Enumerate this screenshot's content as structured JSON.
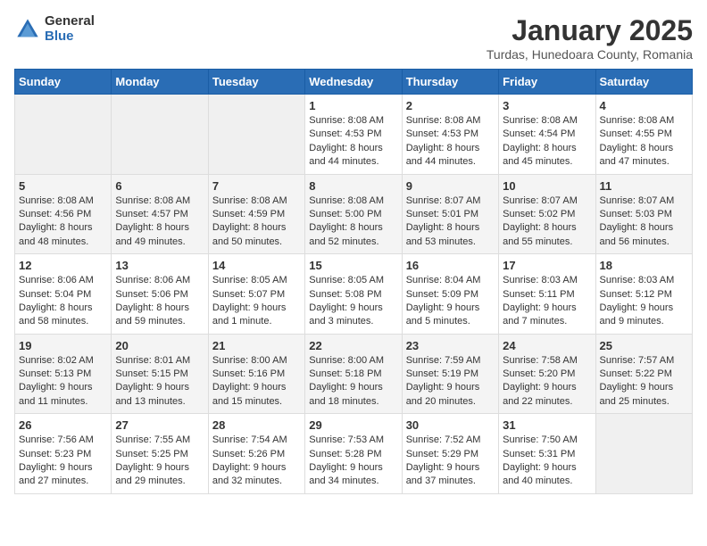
{
  "logo": {
    "general": "General",
    "blue": "Blue"
  },
  "calendar": {
    "title": "January 2025",
    "subtitle": "Turdas, Hunedoara County, Romania"
  },
  "weekdays": [
    "Sunday",
    "Monday",
    "Tuesday",
    "Wednesday",
    "Thursday",
    "Friday",
    "Saturday"
  ],
  "weeks": [
    [
      {
        "day": null
      },
      {
        "day": null
      },
      {
        "day": null
      },
      {
        "day": "1",
        "sunrise": "8:08 AM",
        "sunset": "4:53 PM",
        "daylight": "8 hours and 44 minutes."
      },
      {
        "day": "2",
        "sunrise": "8:08 AM",
        "sunset": "4:53 PM",
        "daylight": "8 hours and 44 minutes."
      },
      {
        "day": "3",
        "sunrise": "8:08 AM",
        "sunset": "4:54 PM",
        "daylight": "8 hours and 45 minutes."
      },
      {
        "day": "4",
        "sunrise": "8:08 AM",
        "sunset": "4:55 PM",
        "daylight": "8 hours and 47 minutes."
      }
    ],
    [
      {
        "day": "5",
        "sunrise": "8:08 AM",
        "sunset": "4:56 PM",
        "daylight": "8 hours and 48 minutes."
      },
      {
        "day": "6",
        "sunrise": "8:08 AM",
        "sunset": "4:57 PM",
        "daylight": "8 hours and 49 minutes."
      },
      {
        "day": "7",
        "sunrise": "8:08 AM",
        "sunset": "4:59 PM",
        "daylight": "8 hours and 50 minutes."
      },
      {
        "day": "8",
        "sunrise": "8:08 AM",
        "sunset": "5:00 PM",
        "daylight": "8 hours and 52 minutes."
      },
      {
        "day": "9",
        "sunrise": "8:07 AM",
        "sunset": "5:01 PM",
        "daylight": "8 hours and 53 minutes."
      },
      {
        "day": "10",
        "sunrise": "8:07 AM",
        "sunset": "5:02 PM",
        "daylight": "8 hours and 55 minutes."
      },
      {
        "day": "11",
        "sunrise": "8:07 AM",
        "sunset": "5:03 PM",
        "daylight": "8 hours and 56 minutes."
      }
    ],
    [
      {
        "day": "12",
        "sunrise": "8:06 AM",
        "sunset": "5:04 PM",
        "daylight": "8 hours and 58 minutes."
      },
      {
        "day": "13",
        "sunrise": "8:06 AM",
        "sunset": "5:06 PM",
        "daylight": "8 hours and 59 minutes."
      },
      {
        "day": "14",
        "sunrise": "8:05 AM",
        "sunset": "5:07 PM",
        "daylight": "9 hours and 1 minute."
      },
      {
        "day": "15",
        "sunrise": "8:05 AM",
        "sunset": "5:08 PM",
        "daylight": "9 hours and 3 minutes."
      },
      {
        "day": "16",
        "sunrise": "8:04 AM",
        "sunset": "5:09 PM",
        "daylight": "9 hours and 5 minutes."
      },
      {
        "day": "17",
        "sunrise": "8:03 AM",
        "sunset": "5:11 PM",
        "daylight": "9 hours and 7 minutes."
      },
      {
        "day": "18",
        "sunrise": "8:03 AM",
        "sunset": "5:12 PM",
        "daylight": "9 hours and 9 minutes."
      }
    ],
    [
      {
        "day": "19",
        "sunrise": "8:02 AM",
        "sunset": "5:13 PM",
        "daylight": "9 hours and 11 minutes."
      },
      {
        "day": "20",
        "sunrise": "8:01 AM",
        "sunset": "5:15 PM",
        "daylight": "9 hours and 13 minutes."
      },
      {
        "day": "21",
        "sunrise": "8:00 AM",
        "sunset": "5:16 PM",
        "daylight": "9 hours and 15 minutes."
      },
      {
        "day": "22",
        "sunrise": "8:00 AM",
        "sunset": "5:18 PM",
        "daylight": "9 hours and 18 minutes."
      },
      {
        "day": "23",
        "sunrise": "7:59 AM",
        "sunset": "5:19 PM",
        "daylight": "9 hours and 20 minutes."
      },
      {
        "day": "24",
        "sunrise": "7:58 AM",
        "sunset": "5:20 PM",
        "daylight": "9 hours and 22 minutes."
      },
      {
        "day": "25",
        "sunrise": "7:57 AM",
        "sunset": "5:22 PM",
        "daylight": "9 hours and 25 minutes."
      }
    ],
    [
      {
        "day": "26",
        "sunrise": "7:56 AM",
        "sunset": "5:23 PM",
        "daylight": "9 hours and 27 minutes."
      },
      {
        "day": "27",
        "sunrise": "7:55 AM",
        "sunset": "5:25 PM",
        "daylight": "9 hours and 29 minutes."
      },
      {
        "day": "28",
        "sunrise": "7:54 AM",
        "sunset": "5:26 PM",
        "daylight": "9 hours and 32 minutes."
      },
      {
        "day": "29",
        "sunrise": "7:53 AM",
        "sunset": "5:28 PM",
        "daylight": "9 hours and 34 minutes."
      },
      {
        "day": "30",
        "sunrise": "7:52 AM",
        "sunset": "5:29 PM",
        "daylight": "9 hours and 37 minutes."
      },
      {
        "day": "31",
        "sunrise": "7:50 AM",
        "sunset": "5:31 PM",
        "daylight": "9 hours and 40 minutes."
      },
      {
        "day": null
      }
    ]
  ]
}
